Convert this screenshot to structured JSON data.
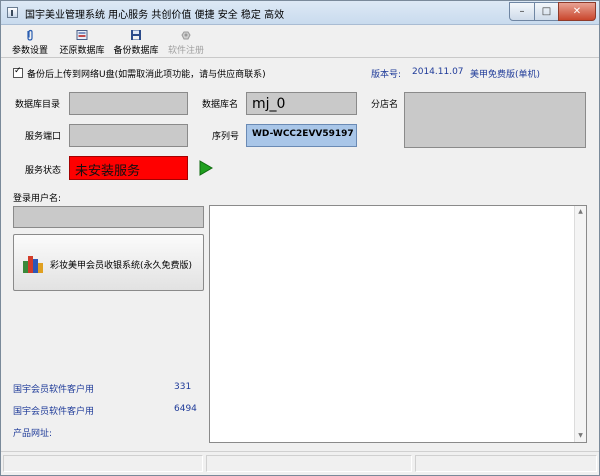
{
  "window": {
    "title": "国宇美业管理系统  用心服务  共创价值  便捷 安全 稳定 高效",
    "min_symbol": "–",
    "max_symbol": "□",
    "close_symbol": "✕"
  },
  "toolbar": {
    "items": [
      {
        "label": "参数设置",
        "icon": "paperclip-icon",
        "enabled": true
      },
      {
        "label": "还原数据库",
        "icon": "restore-database-icon",
        "enabled": true
      },
      {
        "label": "备份数据库",
        "icon": "floppy-disk-icon",
        "enabled": true
      },
      {
        "label": "软件注册",
        "icon": "register-icon",
        "enabled": false
      }
    ]
  },
  "backup": {
    "checked": true,
    "label": "备份后上传到网络U盘(如需取消此项功能，请与供应商联系)"
  },
  "version": {
    "label": "版本号:",
    "value": "2014.11.07",
    "edition": "美甲免费版(单机)"
  },
  "form": {
    "db_dir_label": "数据库目录",
    "db_dir_value": "",
    "db_name_label": "数据库名",
    "db_name_value": "mj_0",
    "branch_label": "分店名",
    "branch_value": "",
    "port_label": "服务端口",
    "port_value": "",
    "serial_label": "序列号",
    "serial_value": "WD-WCC2EVV59197",
    "service_status_label": "服务状态",
    "service_status_value": "未安装服务"
  },
  "login": {
    "label": "登录用户名:",
    "value": ""
  },
  "app_button": {
    "label": "彩妆美甲会员收银系统(永久免费版)",
    "icon": "bar-chart-icon"
  },
  "stats": [
    {
      "label": "国宇会员软件客户用",
      "value": "331"
    },
    {
      "label": "国宇会员软件客户用",
      "value": "6494"
    }
  ],
  "product_url": {
    "label": "产品网址:"
  },
  "scrollbar": {
    "up": "▲",
    "down": "▼"
  },
  "colors": {
    "status_red": "#ff0000",
    "serial_blue": "#a9c6e8",
    "link_blue": "#1f3b99",
    "play_green": "#1fa01f"
  }
}
